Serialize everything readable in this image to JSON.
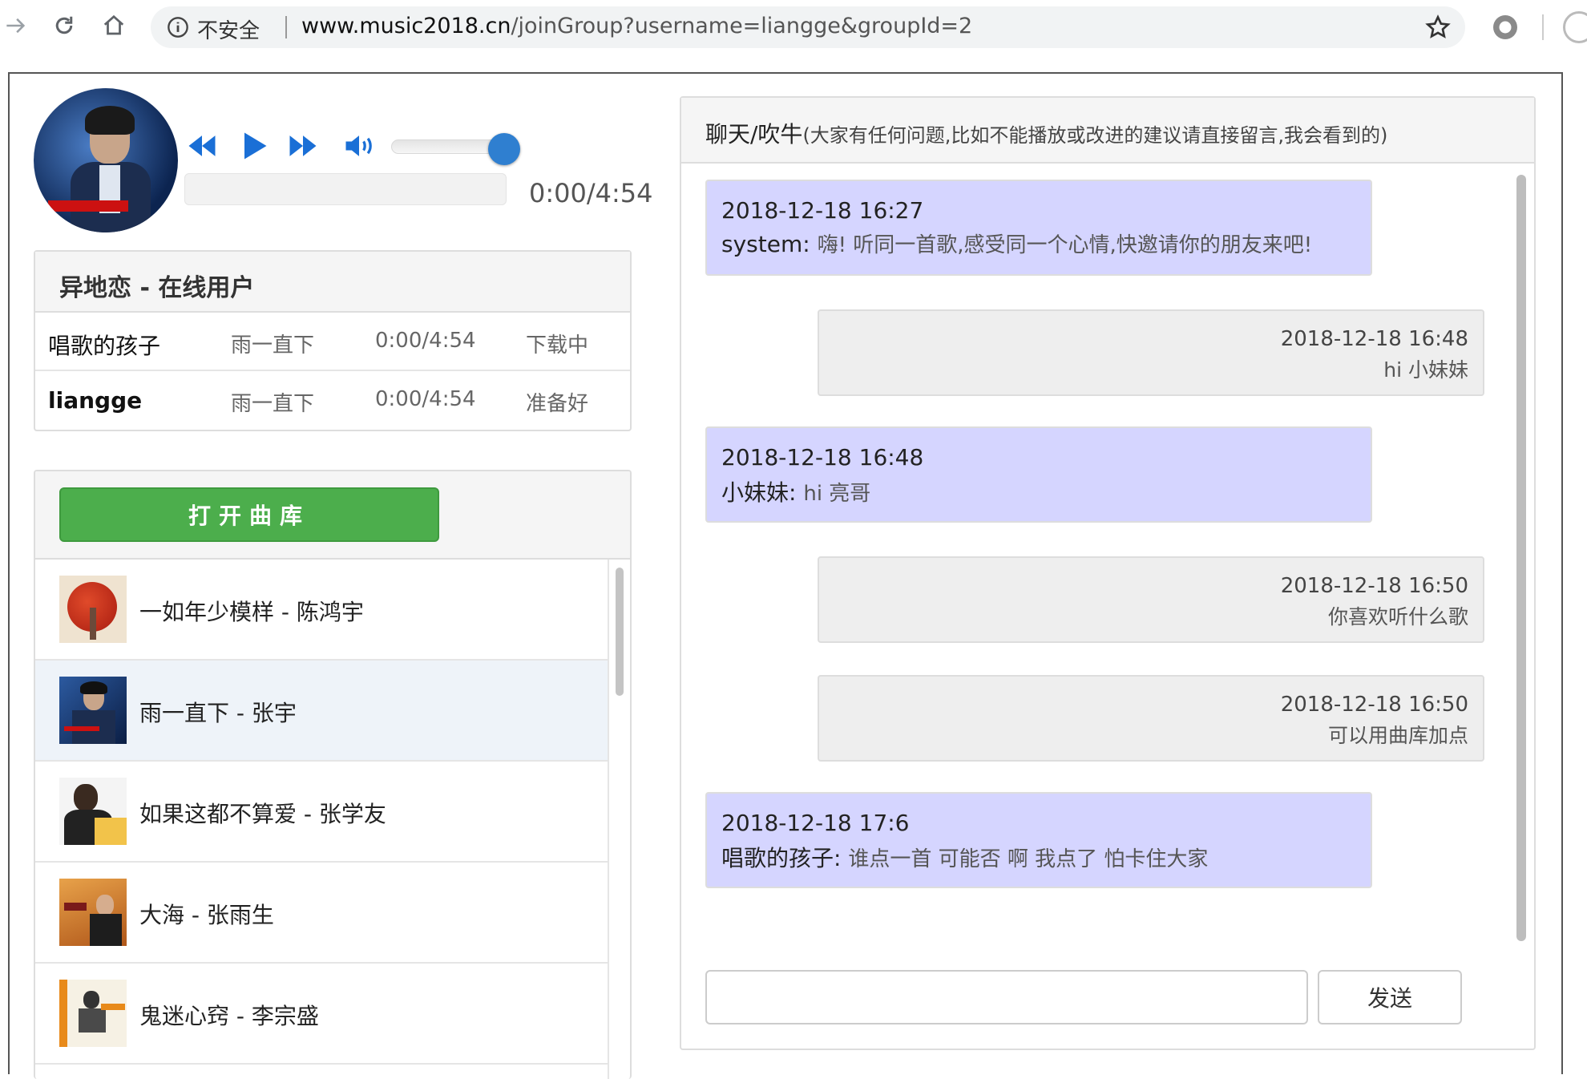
{
  "browser": {
    "security_label": "不安全",
    "url_host": "www.music2018.cn",
    "url_path": "/joinGroup?username=liangge&groupId=2"
  },
  "player": {
    "time": "0:00/4:54",
    "volume_level": 0.9,
    "progress": 0
  },
  "users_panel": {
    "title": "异地恋 - 在线用户",
    "rows": [
      {
        "name": "唱歌的孩子",
        "song": "雨一直下",
        "time": "0:00/4:54",
        "status": "下载中"
      },
      {
        "name": "liangge",
        "song": "雨一直下",
        "time": "0:00/4:54",
        "status": "准备好"
      }
    ]
  },
  "library": {
    "open_button": "打开曲库",
    "songs": [
      {
        "title": "一如年少模样 - 陈鸿宇"
      },
      {
        "title": "雨一直下 - 张宇"
      },
      {
        "title": "如果这都不算爱 - 张学友"
      },
      {
        "title": "大海 - 张雨生"
      },
      {
        "title": "鬼迷心窍 - 李宗盛"
      }
    ]
  },
  "chat": {
    "title": "聊天/吹牛",
    "subtitle": "(大家有任何问题,比如不能播放或改进的建议请直接留言,我会看到的)",
    "messages": [
      {
        "ts": "2018-12-18 16:27",
        "who": "system: ",
        "text": "嗨! 听同一首歌,感受同一个心情,快邀请你的朋友来吧!"
      },
      {
        "ts": "2018-12-18 16:48",
        "text": "hi 小妹妹"
      },
      {
        "ts": "2018-12-18 16:48",
        "who": "小妹妹: ",
        "text": "hi 亮哥"
      },
      {
        "ts": "2018-12-18 16:50",
        "text": "你喜欢听什么歌"
      },
      {
        "ts": "2018-12-18 16:50",
        "text": "可以用曲库加点"
      },
      {
        "ts": "2018-12-18 17:6",
        "who": "唱歌的孩子: ",
        "text": "谁点一首 可能否 啊 我点了 怕卡住大家"
      }
    ],
    "input_value": "",
    "send_label": "发送"
  }
}
